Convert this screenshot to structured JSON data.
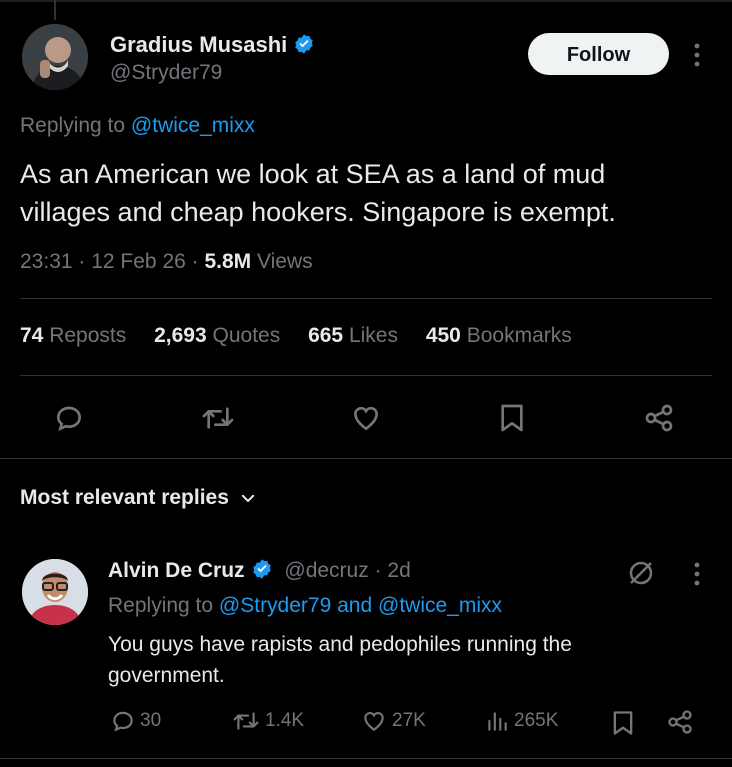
{
  "tweet": {
    "author_name": "Gradius Musashi",
    "author_handle": "@Stryder79",
    "follow_label": "Follow",
    "replying_prefix": "Replying to",
    "replying_handle": "@twice_mixx",
    "text_line1": "As an American we look at SEA as a land of mud",
    "text_line2": "villages and cheap hookers. Singapore is exempt.",
    "time": "23:31",
    "date": "12 Feb 26",
    "views_count": "5.8M",
    "views_label": "Views",
    "reposts_count": "74",
    "reposts_label": "Reposts",
    "quotes_count": "2,693",
    "quotes_label": "Quotes",
    "likes_count": "665",
    "likes_label": "Likes",
    "bookmarks_count": "450",
    "bookmarks_label": "Bookmarks"
  },
  "replies_section": {
    "title": "Most relevant replies"
  },
  "reply": {
    "author_name": "Alvin De Cruz",
    "author_handle": "@decruz",
    "age": "2d",
    "replying_prefix": "Replying to",
    "replying_handle1": "@Stryder79",
    "replying_and": "and",
    "replying_handle2": "@twice_mixx",
    "text_line1": "You guys have rapists and pedophiles running the",
    "text_line2": "government.",
    "reply_count": "30",
    "repost_count": "1.4K",
    "like_count": "27K",
    "view_count": "265K"
  },
  "colors": {
    "background": "#000000",
    "text": "#e7e9ea",
    "secondary": "#71767b",
    "link": "#1d9bf0",
    "divider": "#2f3336"
  },
  "icons": [
    "verified-badge-icon",
    "more-icon",
    "reply-icon",
    "repost-icon",
    "like-icon",
    "bookmark-icon",
    "share-icon",
    "chevron-down-icon",
    "grok-icon",
    "views-icon"
  ]
}
